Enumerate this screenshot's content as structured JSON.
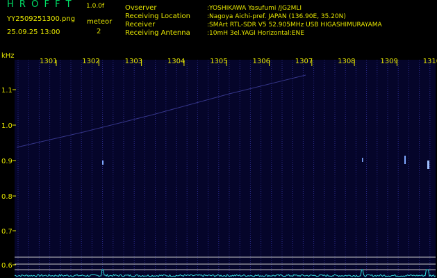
{
  "header": {
    "brand": "H R O F F T",
    "version": "1.0.0f",
    "filename": "YY2509251300.png",
    "meteor_label": "meteor",
    "meteor_count": "2",
    "datetime": "25.09.25 13:00",
    "info": [
      {
        "label": "Ovserver",
        "value": ":YOSHIKAWA Yasufumi /JG2MLI"
      },
      {
        "label": "Receiving Location",
        "value": ":Nagoya Aichi-pref. JAPAN (136.90E, 35.20N)"
      },
      {
        "label": "Receiver",
        "value": ":SMArt RTL-SDR V5 52.905MHz USB HIGASHIMURAYAMA"
      },
      {
        "label": "Receiving Antenna",
        "value": ":10mH 3el.YAGI Horizontal:ENE"
      }
    ]
  },
  "chart_data": {
    "type": "heatmap",
    "ylabel": "kHz",
    "y_ticks": [
      "1.1",
      "1.0",
      "0.9",
      "0.8",
      "0.7",
      "0.6"
    ],
    "x_ticks": [
      "1301",
      "1302",
      "1303",
      "1304",
      "1305",
      "1306",
      "1307",
      "1308",
      "1309",
      "1310"
    ],
    "colors": {
      "background": "#05052a",
      "grid": "#2a2a88",
      "label": "#e6e600",
      "spectrum": "#33e0e0",
      "hline": "#c8c8c8"
    }
  }
}
